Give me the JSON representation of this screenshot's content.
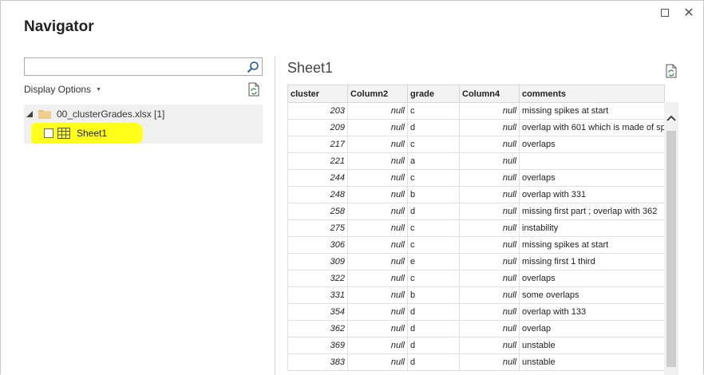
{
  "window": {
    "title": "Navigator",
    "maximize_icon": "maximize-icon",
    "close_icon": "close-icon",
    "close_glyph": "✕"
  },
  "left": {
    "search": {
      "value": "",
      "placeholder": ""
    },
    "display_options_label": "Display Options",
    "file_label": "00_clusterGrades.xlsx [1]",
    "sheet_label": "Sheet1",
    "highlight_color": "#ffff1a"
  },
  "right": {
    "sheet_title": "Sheet1",
    "columns": [
      "cluster",
      "Column2",
      "grade",
      "Column4",
      "comments"
    ],
    "rows": [
      [
        "203",
        "null",
        "c",
        "null",
        "missing spikes at start"
      ],
      [
        "209",
        "null",
        "d",
        "null",
        "overlap with 601 which is made of sp"
      ],
      [
        "217",
        "null",
        "c",
        "null",
        "overlaps"
      ],
      [
        "221",
        "null",
        "a",
        "null",
        ""
      ],
      [
        "244",
        "null",
        "c",
        "null",
        "overlaps"
      ],
      [
        "248",
        "null",
        "b",
        "null",
        "overlap with 331"
      ],
      [
        "258",
        "null",
        "d",
        "null",
        "missing first part ; overlap with 362"
      ],
      [
        "275",
        "null",
        "c",
        "null",
        "instability"
      ],
      [
        "306",
        "null",
        "c",
        "null",
        "missing spikes at start"
      ],
      [
        "309",
        "null",
        "e",
        "null",
        "missing first 1 third"
      ],
      [
        "322",
        "null",
        "c",
        "null",
        "overlaps"
      ],
      [
        "331",
        "null",
        "b",
        "null",
        "some overlaps"
      ],
      [
        "354",
        "null",
        "d",
        "null",
        "overlap with 133"
      ],
      [
        "362",
        "null",
        "d",
        "null",
        "overlap"
      ],
      [
        "369",
        "null",
        "d",
        "null",
        "unstable"
      ],
      [
        "383",
        "null",
        "d",
        "null",
        "unstable"
      ]
    ]
  }
}
